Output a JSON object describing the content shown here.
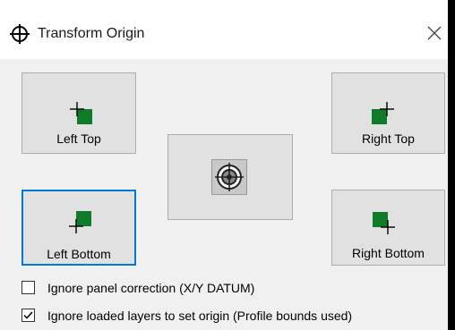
{
  "window": {
    "title": "Transform Origin",
    "title_icon": "crosshair-target-icon",
    "close_icon": "close-icon"
  },
  "buttons": {
    "left_top": "Left Top",
    "right_top": "Right Top",
    "left_bottom": "Left Bottom",
    "right_bottom": "Right Bottom",
    "center_icon": "target-icon",
    "focused": "left_bottom"
  },
  "options": [
    {
      "label": "Ignore panel correction (X/Y DATUM)",
      "checked": false
    },
    {
      "label": "Ignore loaded layers to set origin (Profile bounds used)",
      "checked": true
    }
  ],
  "colors": {
    "accent": "#0078d7",
    "marker_green": "#0f7a2a",
    "button_bg": "#e1e1e1"
  }
}
